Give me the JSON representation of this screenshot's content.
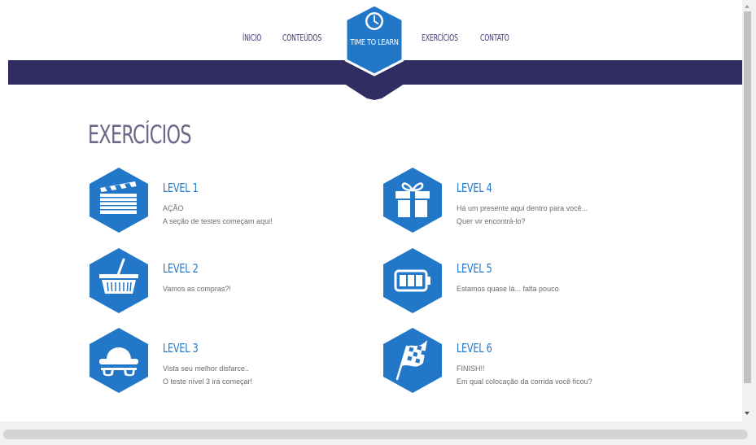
{
  "nav": {
    "items": [
      "ÍNICIO",
      "CONTEÚDOS",
      "EXERCÍCIOS",
      "CONTATO"
    ],
    "logo_label": "TIME TO LEARN",
    "logo_icon": "clock-icon"
  },
  "colors": {
    "navy": "#302d63",
    "blue": "#2377c8",
    "title": "#6c6887"
  },
  "main": {
    "title": "EXERCÍCIOS",
    "levels": [
      {
        "name": "LEVEL 1",
        "line1": "AÇÃO",
        "line2": "A seção de testes começam aqui!",
        "icon": "clapperboard-icon"
      },
      {
        "name": "LEVEL 2",
        "line1": "Vamos as compras?!",
        "line2": "",
        "icon": "basket-icon"
      },
      {
        "name": "LEVEL 3",
        "line1": "Vista seu melhor disfarce..",
        "line2": "O teste nível 3 irá começar!",
        "icon": "disguise-icon"
      },
      {
        "name": "LEVEL 4",
        "line1": "Há um presente aqui dentro para você...",
        "line2": "Quer vir encontrá-lo?",
        "icon": "gift-icon"
      },
      {
        "name": "LEVEL 5",
        "line1": "Estamos quase lá... falta pouco",
        "line2": "",
        "icon": "battery-icon"
      },
      {
        "name": "LEVEL 6",
        "line1": "FINISH!!",
        "line2": "Em qual colocação da corrida você ficou?",
        "icon": "checkered-flag-icon"
      }
    ]
  }
}
